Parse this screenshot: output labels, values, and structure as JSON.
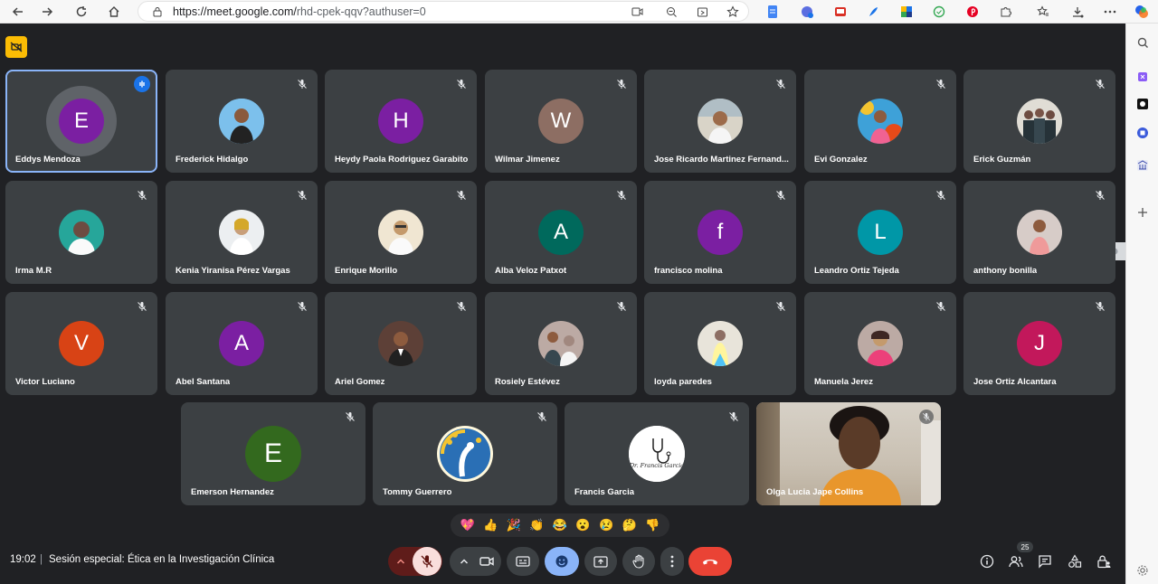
{
  "browser": {
    "url_main": "https://meet.google.com/",
    "url_rest": "rhd-cpek-qqv?authuser=0"
  },
  "meeting": {
    "time": "19:02",
    "separator": "|",
    "title": "Sesión especial: Ética en la Investigación Clínica",
    "people_count": "25"
  },
  "participants": {
    "p1": {
      "name": "Eddys Mendoza",
      "initial": "E",
      "color": "#7b1fa2"
    },
    "p2": {
      "name": "Frederick Hidalgo"
    },
    "p3": {
      "name": "Heydy Paola Rodriguez Garabito",
      "initial": "H",
      "color": "#7b1fa2"
    },
    "p4": {
      "name": "Wilmar Jimenez",
      "initial": "W",
      "color": "#8d6e63"
    },
    "p5": {
      "name": "Jose Ricardo Martinez Fernand..."
    },
    "p6": {
      "name": "Evi Gonzalez"
    },
    "p7": {
      "name": "Erick Guzmán"
    },
    "p8": {
      "name": "Irma M.R"
    },
    "p9": {
      "name": "Kenia Yiranisa Pérez Vargas"
    },
    "p10": {
      "name": "Enrique Morillo"
    },
    "p11": {
      "name": "Alba Veloz Patxot",
      "initial": "A",
      "color": "#00695c"
    },
    "p12": {
      "name": "francisco molina",
      "initial": "f",
      "color": "#7b1fa2"
    },
    "p13": {
      "name": "Leandro Ortiz Tejeda",
      "initial": "L",
      "color": "#0097a7"
    },
    "p14": {
      "name": "anthony bonilla"
    },
    "p15": {
      "name": "Victor Luciano",
      "initial": "V",
      "color": "#d84315"
    },
    "p16": {
      "name": "Abel Santana",
      "initial": "A",
      "color": "#7b1fa2"
    },
    "p17": {
      "name": "Ariel Gomez"
    },
    "p18": {
      "name": "Rosiely Estévez"
    },
    "p19": {
      "name": "loyda paredes"
    },
    "p20": {
      "name": "Manuela Jerez"
    },
    "p21": {
      "name": "Jose Ortiz Alcantara",
      "initial": "J",
      "color": "#c2185b"
    },
    "p22": {
      "name": "Emerson Hernandez",
      "initial": "E",
      "color": "#33691e"
    },
    "p23": {
      "name": "Tommy Guerrero"
    },
    "p24": {
      "name": "Francis Garcia",
      "logo_text": "Dr. Francis Garcia"
    },
    "p25": {
      "name": "Olga Lucia Jape Collins"
    }
  },
  "reactions": [
    "💖",
    "👍",
    "🎉",
    "👏",
    "😂",
    "😮",
    "😢",
    "🤔",
    "👎"
  ],
  "colors": {
    "accent": "#8ab4f8",
    "end_call": "#ea4335",
    "mic_off_bg": "#f9dedc",
    "emoji_active_bg": "#8ab4f8"
  }
}
